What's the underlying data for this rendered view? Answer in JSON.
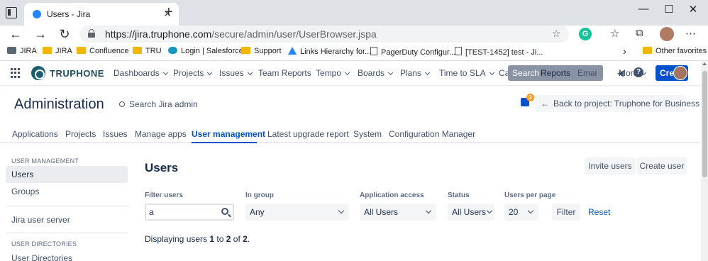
{
  "browser": {
    "tab_title": "Users - Jira",
    "new_tab": "+",
    "url_host": "https://jira.truphone.com",
    "url_path": "/secure/admin/user/UserBrowser.jspa",
    "bookmarks": [
      "JIRA",
      "JIRA",
      "Confluence",
      "TRU",
      "Login | Salesforce",
      "Support",
      "Links Hierarchy for...",
      "PagerDuty Configur...",
      "[TEST-1452] test - Ji..."
    ],
    "other_favorites": "Other favorites",
    "extension_letter": "G"
  },
  "jira_nav": {
    "logo": "TRUPHONE",
    "items": [
      "Dashboards",
      "Projects",
      "Issues",
      "Team Reports",
      "Tempo",
      "Boards",
      "Plans",
      "Time to SLA",
      "Calen",
      "Emai",
      "More"
    ],
    "search_placeholder": "Search",
    "search_overlay": "Reports",
    "create": "Create"
  },
  "admin": {
    "title": "Administration",
    "search": "Search Jira admin",
    "notif_count": "2",
    "back": "Back to project: Truphone for Business",
    "tabs": [
      "Applications",
      "Projects",
      "Issues",
      "Manage apps",
      "User management",
      "Latest upgrade report",
      "System",
      "Configuration Manager"
    ]
  },
  "sidebar": {
    "head1": "USER MANAGEMENT",
    "items1": [
      "Users",
      "Groups"
    ],
    "item2": "Jira user server",
    "head2": "USER DIRECTORIES",
    "item3": "User Directories"
  },
  "main": {
    "title": "Users",
    "invite": "Invite users",
    "create_user": "Create user",
    "filter_users_label": "Filter users",
    "filter_users_value": "a",
    "in_group_label": "In group",
    "in_group_value": "Any",
    "app_access_label": "Application access",
    "app_access_value": "All Users",
    "status_label": "Status",
    "status_value": "All Users",
    "per_page_label": "Users per page",
    "per_page_value": "20",
    "filter": "Filter",
    "reset": "Reset",
    "displaying_prefix": "Displaying users ",
    "from": "1",
    "to_word": " to ",
    "to": "2",
    "of_word": " of ",
    "total": "2",
    "end": "."
  }
}
